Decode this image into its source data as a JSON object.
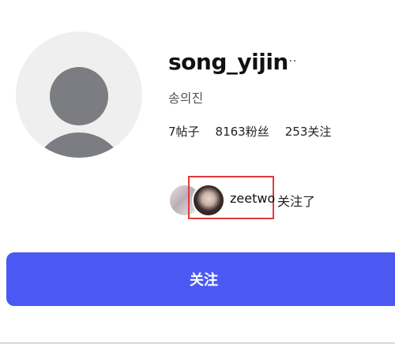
{
  "profile": {
    "username": "song_yijin",
    "more_icon": "···",
    "full_name": "송의진",
    "stats": {
      "posts": "7帖子",
      "followers": "8163粉丝",
      "following": "253关注"
    },
    "followed_by": {
      "name": "zeetwo",
      "suffix": "关注了"
    },
    "follow_button_label": "关注"
  },
  "colors": {
    "accent": "#4b59f2",
    "highlight": "#e03b3b"
  }
}
